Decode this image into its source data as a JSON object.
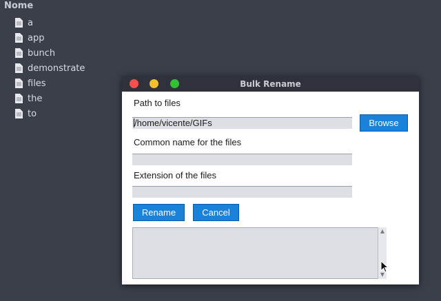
{
  "file_manager": {
    "header": "Nome",
    "items": [
      "a",
      "app",
      "bunch",
      "demonstrate",
      "files",
      "the",
      "to"
    ]
  },
  "dialog": {
    "title": "Bulk Rename",
    "path_label": "Path to files",
    "path_value": "/home/vicente/GIFs",
    "browse_label": "Browse",
    "common_name_label": "Common name for the files",
    "common_name_value": "",
    "extension_label": "Extension of the files",
    "extension_value": "",
    "rename_label": "Rename",
    "cancel_label": "Cancel",
    "output_text": ""
  },
  "colors": {
    "accent_button": "#1a82d9",
    "close": "#fc4e4a",
    "minimize": "#f3c02a",
    "maximize": "#30c233"
  },
  "icons": {
    "file": "file-icon",
    "scroll_up": "scroll-up-arrow-icon",
    "scroll_down": "scroll-down-arrow-icon",
    "pointer": "mouse-pointer-icon"
  }
}
